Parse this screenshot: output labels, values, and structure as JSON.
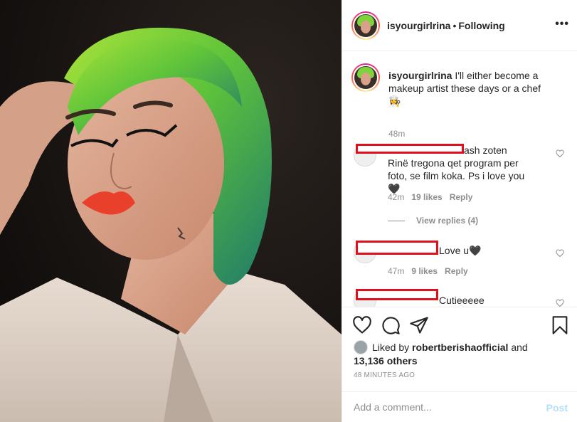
{
  "header": {
    "username": "isyourgirlrina",
    "separator": "•",
    "follow_status": "Following",
    "more_label": "•••"
  },
  "caption": {
    "username": "isyourgirlrina",
    "text": "I'll either become a makeup artist these days or a chef",
    "emoji": "👩‍🍳",
    "time": "48m"
  },
  "comments": [
    {
      "text": "ash zoten Rinë tregona qet program per foto, se film koka. Ps i love you🖤",
      "time": "42m",
      "likes": "19 likes",
      "reply": "Reply",
      "view_replies": "View replies (4)"
    },
    {
      "text": "Love u🖤",
      "time": "47m",
      "likes": "9 likes",
      "reply": "Reply"
    },
    {
      "text": "Cutieeeee"
    }
  ],
  "likes": {
    "prefix": "Liked by",
    "user": "robertberishaofficial",
    "and": "and",
    "others": "13,136 others"
  },
  "posted_time": "48 MINUTES AGO",
  "add_comment": {
    "placeholder": "Add a comment...",
    "post_label": "Post"
  },
  "colors": {
    "redaction": "#e0101f",
    "hair": "#7fd33a",
    "lips": "#e8402a",
    "post_disabled": "#b2dffc"
  }
}
